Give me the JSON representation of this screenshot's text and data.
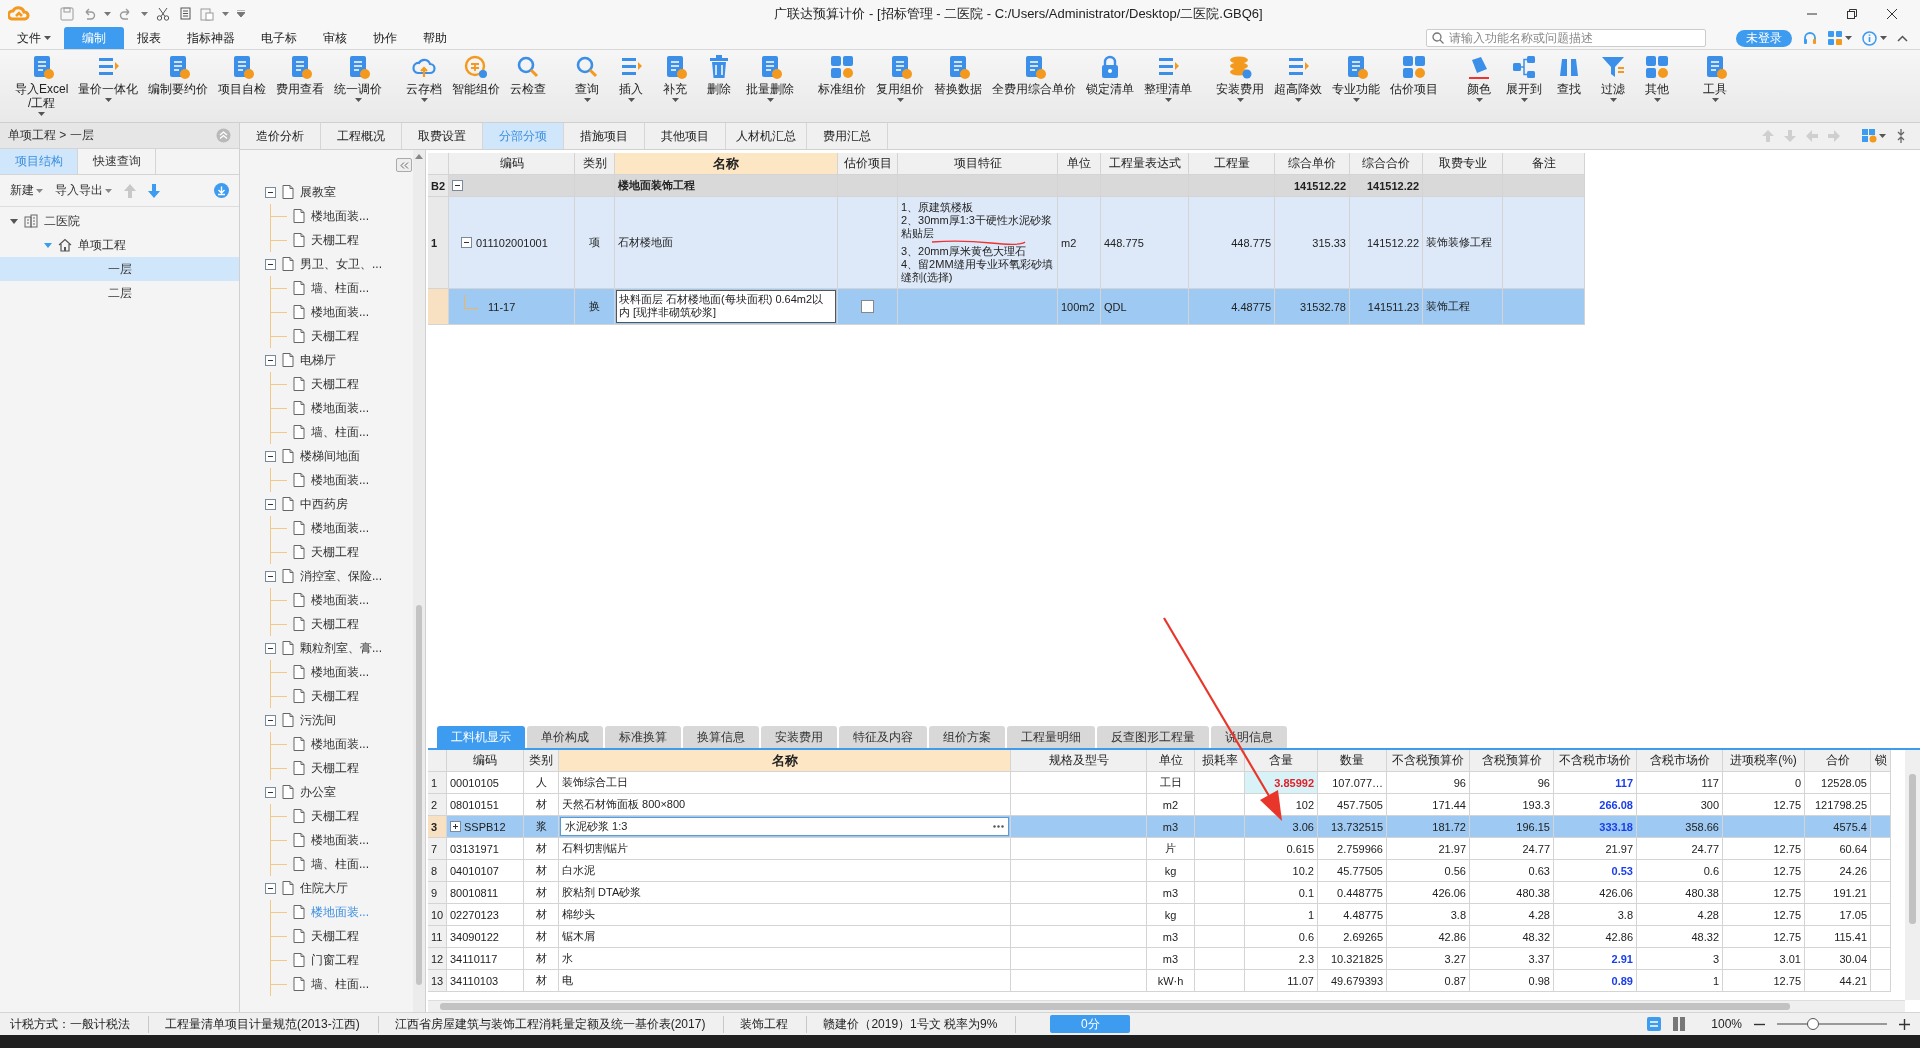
{
  "title_bar": {
    "title": "广联达预算计价 - [招标管理 - 二医院 - C:/Users/Administrator/Desktop/二医院.GBQ6]"
  },
  "menu": [
    {
      "label": "文件",
      "selected": false,
      "dropdown": true
    },
    {
      "label": "编制",
      "selected": true,
      "dropdown": false
    },
    {
      "label": "报表",
      "selected": false,
      "dropdown": false
    },
    {
      "label": "指标神器",
      "selected": false,
      "dropdown": false
    },
    {
      "label": "电子标",
      "selected": false,
      "dropdown": false
    },
    {
      "label": "审核",
      "selected": false,
      "dropdown": false
    },
    {
      "label": "协作",
      "selected": false,
      "dropdown": false
    },
    {
      "label": "帮助",
      "selected": false,
      "dropdown": false
    }
  ],
  "search": {
    "placeholder": "请输入功能名称或问题描述"
  },
  "login_button": "未登录",
  "ribbon": [
    {
      "label": "导入Excel\n/工程",
      "dropdown": true
    },
    {
      "label": "量价一体化",
      "dropdown": true
    },
    {
      "label": "编制要约价",
      "dropdown": false
    },
    {
      "label": "项目自检",
      "dropdown": false
    },
    {
      "label": "费用查看",
      "dropdown": false
    },
    {
      "label": "统一调价",
      "dropdown": true
    },
    {
      "label": "云存档",
      "dropdown": true
    },
    {
      "label": "智能组价",
      "dropdown": false
    },
    {
      "label": "云检查",
      "dropdown": false
    },
    {
      "label": "查询",
      "dropdown": true
    },
    {
      "label": "插入",
      "dropdown": true
    },
    {
      "label": "补充",
      "dropdown": true
    },
    {
      "label": "删除",
      "dropdown": false
    },
    {
      "label": "批量删除",
      "dropdown": true
    },
    {
      "label": "标准组价",
      "dropdown": false
    },
    {
      "label": "复用组价",
      "dropdown": true
    },
    {
      "label": "替换数据",
      "dropdown": false
    },
    {
      "label": "全费用综合单价",
      "dropdown": false
    },
    {
      "label": "锁定清单",
      "dropdown": false
    },
    {
      "label": "整理清单",
      "dropdown": true
    },
    {
      "label": "安装费用",
      "dropdown": true
    },
    {
      "label": "超高降效",
      "dropdown": true
    },
    {
      "label": "专业功能",
      "dropdown": true
    },
    {
      "label": "估价项目",
      "dropdown": false
    },
    {
      "label": "颜色",
      "dropdown": true
    },
    {
      "label": "展开到",
      "dropdown": true
    },
    {
      "label": "查找",
      "dropdown": false
    },
    {
      "label": "过滤",
      "dropdown": true
    },
    {
      "label": "其他",
      "dropdown": true
    },
    {
      "label": "工具",
      "dropdown": true
    }
  ],
  "project_panel": {
    "breadcrumb": "单项工程 > 一层",
    "tabs": [
      {
        "label": "项目结构",
        "selected": true
      },
      {
        "label": "快速查询",
        "selected": false
      }
    ],
    "toolbar": [
      {
        "label": "新建"
      },
      {
        "label": "导入导出"
      }
    ],
    "move_buttons": [
      {
        "disabled": true
      },
      {
        "disabled": false
      }
    ],
    "tree": [
      {
        "label": "二医院",
        "expanded": true,
        "selected": false,
        "children": [
          {
            "label": "单项工程",
            "expanded": true,
            "selected": false,
            "children": [
              {
                "label": "一层",
                "selected": true
              },
              {
                "label": "二层",
                "selected": false
              }
            ]
          }
        ]
      }
    ]
  },
  "section_tree": [
    {
      "label": "展教室",
      "expanded": true,
      "selected": false,
      "children": [
        {
          "label": "楼地面装...",
          "selected": false
        },
        {
          "label": "天棚工程",
          "selected": false
        }
      ]
    },
    {
      "label": "男卫、女卫、...",
      "expanded": true,
      "selected": false,
      "children": [
        {
          "label": "墙、柱面...",
          "selected": false
        },
        {
          "label": "楼地面装...",
          "selected": false
        },
        {
          "label": "天棚工程",
          "selected": false
        }
      ]
    },
    {
      "label": "电梯厅",
      "expanded": true,
      "selected": false,
      "children": [
        {
          "label": "天棚工程",
          "selected": false
        },
        {
          "label": "楼地面装...",
          "selected": false
        },
        {
          "label": "墙、柱面...",
          "selected": false
        }
      ]
    },
    {
      "label": "楼梯间地面",
      "expanded": true,
      "selected": false,
      "children": [
        {
          "label": "楼地面装...",
          "selected": false
        }
      ]
    },
    {
      "label": "中西药房",
      "expanded": true,
      "selected": false,
      "children": [
        {
          "label": "楼地面装...",
          "selected": false
        },
        {
          "label": "天棚工程",
          "selected": false
        }
      ]
    },
    {
      "label": "消控室、保险...",
      "expanded": true,
      "selected": false,
      "children": [
        {
          "label": "楼地面装...",
          "selected": false
        },
        {
          "label": "天棚工程",
          "selected": false
        }
      ]
    },
    {
      "label": "颗粒剂室、膏...",
      "expanded": true,
      "selected": false,
      "children": [
        {
          "label": "楼地面装...",
          "selected": false
        },
        {
          "label": "天棚工程",
          "selected": false
        }
      ]
    },
    {
      "label": "污洗间",
      "expanded": true,
      "selected": false,
      "children": [
        {
          "label": "楼地面装...",
          "selected": false
        },
        {
          "label": "天棚工程",
          "selected": false
        }
      ]
    },
    {
      "label": "办公室",
      "expanded": true,
      "selected": false,
      "children": [
        {
          "label": "天棚工程",
          "selected": false
        },
        {
          "label": "楼地面装...",
          "selected": false
        },
        {
          "label": "墙、柱面...",
          "selected": false
        }
      ]
    },
    {
      "label": "住院大厅",
      "expanded": true,
      "selected": false,
      "children": [
        {
          "label": "楼地面装...",
          "selected": true
        },
        {
          "label": "天棚工程",
          "selected": false
        },
        {
          "label": "门窗工程",
          "selected": false
        },
        {
          "label": "墙、柱面...",
          "selected": false
        }
      ]
    }
  ],
  "main_tabs": [
    {
      "label": "造价分析",
      "selected": false
    },
    {
      "label": "工程概况",
      "selected": false
    },
    {
      "label": "取费设置",
      "selected": false
    },
    {
      "label": "分部分项",
      "selected": true
    },
    {
      "label": "措施项目",
      "selected": false
    },
    {
      "label": "其他项目",
      "selected": false
    },
    {
      "label": "人材机汇总",
      "selected": false
    },
    {
      "label": "费用汇总",
      "selected": false
    }
  ],
  "bill_table": {
    "columns": [
      "编码",
      "类别",
      "名称",
      "估价项目",
      "项目特征",
      "单位",
      "工程量表达式",
      "工程量",
      "综合单价",
      "综合合价",
      "取费专业",
      "备注"
    ],
    "rows": [
      {
        "kind": "group",
        "number": "B2",
        "expanded": true,
        "selected": false,
        "name": "楼地面装饰工程",
        "unit_price": "141512.22",
        "total": "141512.22"
      },
      {
        "kind": "item",
        "number": "1",
        "expanded": true,
        "selected": false,
        "code": "011102001001",
        "type": "项",
        "name": "石材楼地面",
        "features": [
          "1、原建筑楼板",
          "2、30mm厚1:3干硬性水泥砂浆粘贴层",
          "3、20mm厚米黄色大理石",
          "4、留2MM缝用专业环氧彩砂填缝剂(选择)"
        ],
        "unit": "m2",
        "qty_expr": "448.775",
        "qty": "448.775",
        "unit_price": "315.33",
        "total": "141512.22",
        "fee_type": "装饰装修工程"
      },
      {
        "kind": "sub",
        "selected": true,
        "code": "11-17",
        "type": "换",
        "name": "块料面层 石材楼地面(每块面积) 0.64m2以内 [现拌非砌筑砂浆]",
        "estimate_checked": false,
        "unit": "100m2",
        "qty_expr": "QDL",
        "qty": "4.48775",
        "unit_price": "31532.78",
        "total": "141511.23",
        "fee_type": "装饰工程"
      }
    ]
  },
  "detail_tabs": [
    {
      "label": "工料机显示",
      "selected": true
    },
    {
      "label": "单价构成",
      "selected": false
    },
    {
      "label": "标准换算",
      "selected": false
    },
    {
      "label": "换算信息",
      "selected": false
    },
    {
      "label": "安装费用",
      "selected": false
    },
    {
      "label": "特征及内容",
      "selected": false
    },
    {
      "label": "组价方案",
      "selected": false
    },
    {
      "label": "工程量明细",
      "selected": false
    },
    {
      "label": "反查图形工程量",
      "selected": false
    },
    {
      "label": "说明信息",
      "selected": false
    }
  ],
  "resource_table": {
    "columns": [
      "编码",
      "类别",
      "名称",
      "规格及型号",
      "单位",
      "损耗率",
      "含量",
      "数量",
      "不含税预算价",
      "含税预算价",
      "不含税市场价",
      "含税市场价",
      "进项税率(%)",
      "合价",
      "锁"
    ],
    "rows": [
      {
        "kind": "plain",
        "number": "1",
        "code": "00010105",
        "type": "人",
        "name": "装饰综合工日",
        "unit": "工日",
        "content": "3.85992",
        "quantity": "107.077…",
        "price_ex": "96",
        "price_in": "96",
        "market_ex": "117",
        "market_in": "117",
        "tax_rate": "0",
        "amount": "12528.05",
        "selected": false,
        "editing": false,
        "content_highlighted": true,
        "market_highlighted": true
      },
      {
        "kind": "plain",
        "number": "2",
        "code": "08010151",
        "type": "材",
        "name": "天然石材饰面板 800×800",
        "unit": "m2",
        "content": "102",
        "quantity": "457.7505",
        "price_ex": "171.44",
        "price_in": "193.3",
        "market_ex": "266.08",
        "market_in": "300",
        "tax_rate": "12.75",
        "amount": "121798.25",
        "selected": false,
        "editing": false,
        "content_highlighted": false,
        "market_highlighted": true
      },
      {
        "kind": "composite",
        "expanded": false,
        "number": "3",
        "code": "SSPB12",
        "type": "浆",
        "name": "水泥砂浆 1:3",
        "unit": "m3",
        "content": "3.06",
        "quantity": "13.732515",
        "price_ex": "181.72",
        "price_in": "196.15",
        "market_ex": "333.18",
        "market_in": "358.66",
        "amount": "4575.4",
        "selected": true,
        "editing": true,
        "content_highlighted": false,
        "market_highlighted": true
      },
      {
        "kind": "plain",
        "number": "7",
        "code": "03131971",
        "type": "材",
        "name": "石料切割锯片",
        "unit": "片",
        "content": "0.615",
        "quantity": "2.759966",
        "price_ex": "21.97",
        "price_in": "24.77",
        "market_ex": "21.97",
        "market_in": "24.77",
        "tax_rate": "12.75",
        "amount": "60.64",
        "selected": false,
        "editing": false,
        "content_highlighted": false,
        "market_highlighted": false
      },
      {
        "kind": "plain",
        "number": "8",
        "code": "04010107",
        "type": "材",
        "name": "白水泥",
        "unit": "kg",
        "content": "10.2",
        "quantity": "45.77505",
        "price_ex": "0.56",
        "price_in": "0.63",
        "market_ex": "0.53",
        "market_in": "0.6",
        "tax_rate": "12.75",
        "amount": "24.26",
        "selected": false,
        "editing": false,
        "content_highlighted": false,
        "market_highlighted": true
      },
      {
        "kind": "plain",
        "number": "9",
        "code": "80010811",
        "type": "材",
        "name": "胶粘剂 DTA砂浆",
        "unit": "m3",
        "content": "0.1",
        "quantity": "0.448775",
        "price_ex": "426.06",
        "price_in": "480.38",
        "market_ex": "426.06",
        "market_in": "480.38",
        "tax_rate": "12.75",
        "amount": "191.21",
        "selected": false,
        "editing": false,
        "content_highlighted": false,
        "market_highlighted": false
      },
      {
        "kind": "plain",
        "number": "10",
        "code": "02270123",
        "type": "材",
        "name": "棉纱头",
        "unit": "kg",
        "content": "1",
        "quantity": "4.48775",
        "price_ex": "3.8",
        "price_in": "4.28",
        "market_ex": "3.8",
        "market_in": "4.28",
        "tax_rate": "12.75",
        "amount": "17.05",
        "selected": false,
        "editing": false,
        "content_highlighted": false,
        "market_highlighted": false
      },
      {
        "kind": "plain",
        "number": "11",
        "code": "34090122",
        "type": "材",
        "name": "锯木屑",
        "unit": "m3",
        "content": "0.6",
        "quantity": "2.69265",
        "price_ex": "42.86",
        "price_in": "48.32",
        "market_ex": "42.86",
        "market_in": "48.32",
        "tax_rate": "12.75",
        "amount": "115.41",
        "selected": false,
        "editing": false,
        "content_highlighted": false,
        "market_highlighted": false
      },
      {
        "kind": "plain",
        "number": "12",
        "code": "34110117",
        "type": "材",
        "name": "水",
        "unit": "m3",
        "content": "2.3",
        "quantity": "10.321825",
        "price_ex": "3.27",
        "price_in": "3.37",
        "market_ex": "2.91",
        "market_in": "3",
        "tax_rate": "3.01",
        "amount": "30.04",
        "selected": false,
        "editing": false,
        "content_highlighted": false,
        "market_highlighted": true
      },
      {
        "kind": "plain",
        "number": "13",
        "code": "34110103",
        "type": "材",
        "name": "电",
        "unit": "kW·h",
        "content": "11.07",
        "quantity": "49.679393",
        "price_ex": "0.87",
        "price_in": "0.98",
        "market_ex": "0.89",
        "market_in": "1",
        "tax_rate": "12.75",
        "amount": "44.21",
        "selected": false,
        "editing": false,
        "content_highlighted": false,
        "market_highlighted": true
      }
    ]
  },
  "status_bar": {
    "items": [
      "计税方式：一般计税法",
      "工程量清单项目计量规范(2013-江西)",
      "江西省房屋建筑与装饰工程消耗量定额及统一基价表(2017)",
      "装饰工程",
      "赣建价（2019）1号文 税率为9%"
    ],
    "score_button": "0分",
    "zoom": "100%",
    "zoom_slider": {
      "level": 0.33
    }
  }
}
